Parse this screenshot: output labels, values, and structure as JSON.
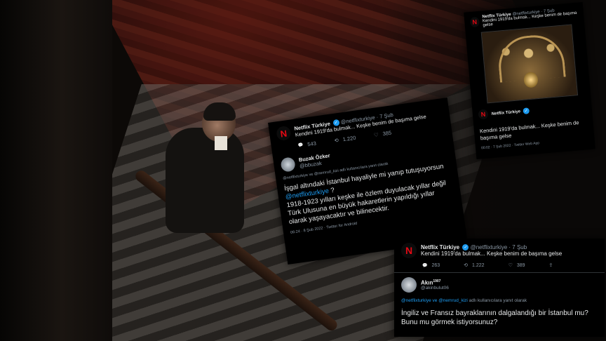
{
  "tweet_center": {
    "author_name": "Netflix Türkiye",
    "author_handle": "@netflixturkiye · 7 Şub",
    "body": "Kendini 1919'da bulmak... Keşke benim de başıma gelse",
    "stats": {
      "replies": "543",
      "retweets": "1.220",
      "likes": "385"
    },
    "reply": {
      "name": "Buzak Özker",
      "handle": "@bbuzak",
      "replying_to": "@netflixturkiye ve @nemrud_kizi adlı kullanıcılara yanıt olarak",
      "text_line1": "İşgal altındaki İstanbul hayaliyle mi yanıp tutuşuyorsun",
      "mention": "@netflixturkiye",
      "text_after_mention": " ?",
      "text_line3": "1918-1923 yılları keşke ile özlem duyulacak yıllar değil",
      "text_line4": "Türk Ulusuna en büyük hakaretlerin yapıldığı yıllar",
      "text_line5": "olarak yaşayacaktır ve bilinecektir.",
      "meta": "06:24 · 8 Şub 2022 · Twitter for Android"
    }
  },
  "tweet_topright": {
    "author_name": "Netflix Türkiye",
    "author_handle": "@netflixturkiye · 7 Şub",
    "body_line": "Kendini 1919'da bulmak... Keşke benim de başıma gelse",
    "footer": "Kendini 1919'da bulmak... Keşke benim de başıma gelse",
    "meta": "00:02 · 7 Şub 2022 · Twitter Web App"
  },
  "tweet_bottomright": {
    "author_name": "Netflix Türkiye",
    "author_handle": "@netflixturkiye · 7 Şub",
    "body": "Kendini 1919'da bulmak... Keşke benim de başıma gelse",
    "stats": {
      "replies": "263",
      "retweets": "1.222",
      "likes": "389"
    },
    "reply": {
      "name": "Akın",
      "name_suffix": "1907",
      "handle": "@akinbulut06",
      "replying_mentions": "@netflixturkiye ve @nemrud_kizi",
      "replying_rest": " adlı kullanıcılara yanıt olarak",
      "text": "İngiliz ve Fransız bayraklarının dalgalandığı bir İstanbul mu? Bunu mu görmek istiyorsunuz?"
    }
  },
  "icons": {
    "netflix_logo": "N",
    "verified": "✓",
    "reply": "💬",
    "retweet": "⟲",
    "like": "♡",
    "share": "⇪"
  },
  "colors": {
    "netflix_red": "#e50914",
    "link_blue": "#1d9bf0",
    "muted": "#8b98a5"
  }
}
